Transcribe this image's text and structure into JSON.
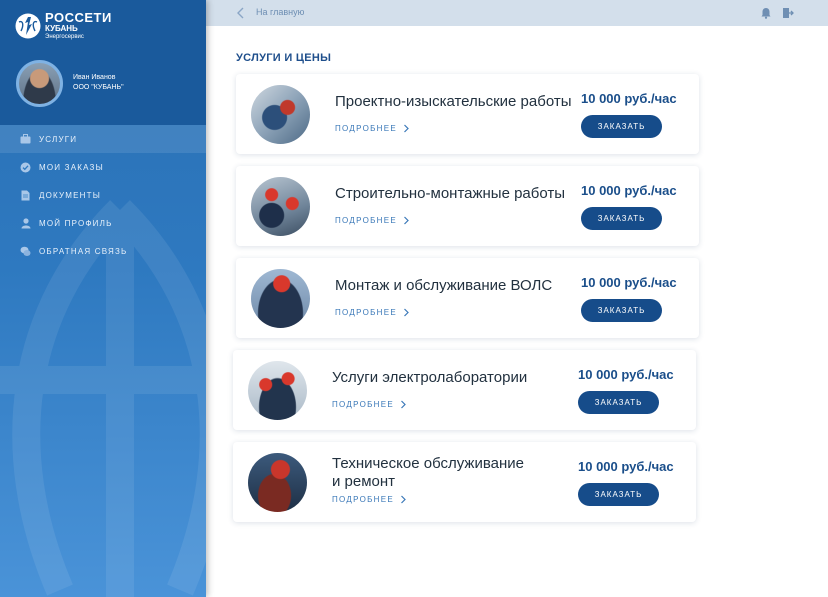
{
  "brand": {
    "title": "РОССЕТИ",
    "subtitle": "КУБАНЬ",
    "tagline": "Энергосервис"
  },
  "user": {
    "name": "Иван Иванов",
    "org": "ООО \"КУБАНЬ\""
  },
  "sidebar": {
    "items": [
      {
        "label": "УСЛУГИ",
        "icon": "briefcase-icon",
        "active": true
      },
      {
        "label": "МОИ ЗАКАЗЫ",
        "icon": "check-circle-icon",
        "active": false
      },
      {
        "label": "ДОКУМЕНТЫ",
        "icon": "document-icon",
        "active": false
      },
      {
        "label": "МОЙ ПРОФИЛЬ",
        "icon": "user-icon",
        "active": false
      },
      {
        "label": "ОБРАТНАЯ СВЯЗЬ",
        "icon": "chat-bubbles-icon",
        "active": false
      }
    ]
  },
  "topbar": {
    "back_label": "На главную"
  },
  "main": {
    "title": "УСЛУГИ И ЦЕНЫ",
    "services": [
      {
        "title": "Проектно-изыскательские работы",
        "more": "ПОДРОБНЕЕ",
        "price": "10 000 руб./час",
        "button": "ЗАКАЗАТЬ"
      },
      {
        "title": "Строительно-монтажные работы",
        "more": "ПОДРОБНЕЕ",
        "price": "10 000 руб./час",
        "button": "ЗАКАЗАТЬ"
      },
      {
        "title": "Монтаж и обслуживание ВОЛС",
        "more": "ПОДРОБНЕЕ",
        "price": "10 000 руб./час",
        "button": "ЗАКАЗАТЬ"
      },
      {
        "title": "Услуги электролаборатории",
        "more": "ПОДРОБНЕЕ",
        "price": "10 000 руб./час",
        "button": "ЗАКАЗАТЬ"
      },
      {
        "title_line1": "Техническое обслуживание",
        "title_line2": "и ремонт",
        "more": "ПОДРОБНЕЕ",
        "price": "10 000 руб./час",
        "button": "ЗАКАЗАТЬ"
      }
    ]
  },
  "colors": {
    "sidebar": "#2e79c0",
    "sidebar_top": "#1a5a9c",
    "accent": "#164c8a",
    "topbar": "#d3dfeb"
  }
}
